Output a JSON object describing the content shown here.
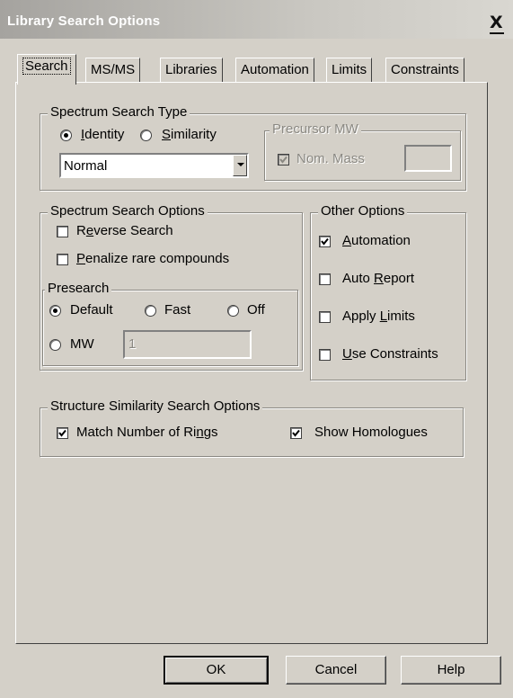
{
  "window": {
    "title": "Library Search Options",
    "close_glyph": "X"
  },
  "tabs": [
    {
      "label": "Search",
      "active": true
    },
    {
      "label": "MS/MS"
    },
    {
      "label": "Libraries"
    },
    {
      "label": "Automation"
    },
    {
      "label": "Limits"
    },
    {
      "label": "Constraints"
    }
  ],
  "spectrum_search_type": {
    "legend": "Spectrum Search Type",
    "identity": {
      "label_u": "I",
      "label_rest": "dentity",
      "selected": true
    },
    "similarity": {
      "label_u": "S",
      "label_rest": "imilarity",
      "selected": false
    },
    "mode_select": {
      "value": "Normal"
    }
  },
  "precursor_mw": {
    "legend": "Precursor MW",
    "nom_mass": {
      "label": "Nom. Mass",
      "checked": true,
      "disabled": true
    },
    "value": ""
  },
  "spectrum_search_options": {
    "legend": "Spectrum Search Options",
    "reverse_search": {
      "label_pre": "R",
      "label_u": "e",
      "label_rest": "verse Search",
      "checked": false
    },
    "penalize": {
      "label_u": "P",
      "label_rest": "enalize rare compounds",
      "checked": false
    }
  },
  "presearch": {
    "legend": "Presearch",
    "default": {
      "label": "Default",
      "selected": true
    },
    "fast": {
      "label": "Fast",
      "selected": false
    },
    "off": {
      "label": "Off",
      "selected": false
    },
    "mw": {
      "label": "MW",
      "selected": false,
      "value": "1"
    }
  },
  "other_options": {
    "legend": "Other Options",
    "automation": {
      "label_u": "A",
      "label_rest": "utomation",
      "checked": true
    },
    "auto_report": {
      "label_pre": "Auto ",
      "label_u": "R",
      "label_rest": "eport",
      "checked": false
    },
    "apply_limits": {
      "label_pre": "Apply ",
      "label_u": "L",
      "label_rest": "imits",
      "checked": false
    },
    "use_constraints": {
      "label_u": "U",
      "label_rest": "se Constraints",
      "checked": false
    }
  },
  "structure_similarity": {
    "legend": "Structure Similarity Search Options",
    "match_rings": {
      "label_pre": "Match Number of Ri",
      "label_u": "n",
      "label_rest": "gs",
      "checked": true
    },
    "show_homologues": {
      "label": "Show Homologues",
      "checked": true
    }
  },
  "buttons": {
    "ok": "OK",
    "cancel": "Cancel",
    "help": "Help"
  },
  "colors": {
    "face": "#d4d0c8",
    "title_bar": "#a5a39f",
    "disabled_text": "#8a8882"
  }
}
